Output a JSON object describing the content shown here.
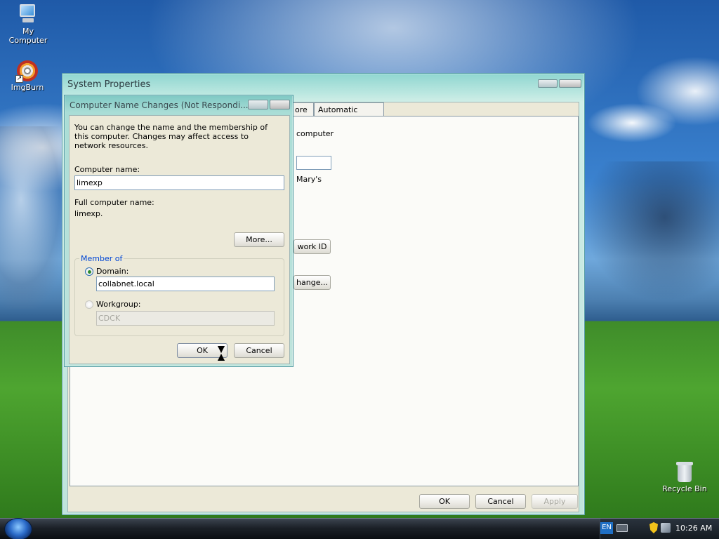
{
  "desktop": {
    "icons": [
      {
        "label": "My Computer"
      },
      {
        "label": "ImgBurn"
      },
      {
        "label": "Recycle Bin"
      }
    ]
  },
  "system_properties": {
    "title": "System Properties",
    "tabs": [
      {
        "label": "ore"
      },
      {
        "label": "Automatic Updates"
      }
    ],
    "panel_fragments": {
      "computer_text": "computer",
      "marys_text": "Mary's"
    },
    "network_id_button": "work ID",
    "change_button": "hange...",
    "ok_button": "OK",
    "cancel_button": "Cancel",
    "apply_button": "Apply"
  },
  "dialog": {
    "title": "Computer Name Changes (Not Respondi...",
    "description": "You can change the name and the membership of this computer. Changes may affect access to network resources.",
    "computer_name_label": "Computer name:",
    "computer_name_value": "limexp",
    "full_name_label": "Full computer name:",
    "full_name_value": "limexp.",
    "more_button": "More...",
    "member_of_label": "Member of",
    "domain_label": "Domain:",
    "domain_value": "collabnet.local",
    "domain_selected": true,
    "workgroup_label": "Workgroup:",
    "workgroup_value": "CDCK",
    "ok_button": "OK",
    "cancel_button": "Cancel"
  },
  "taskbar": {
    "language": "EN",
    "clock": "10:26 AM"
  },
  "colors": {
    "title_glass": "#a9ddd6",
    "dialog_face": "#ece9d8",
    "group_legend": "#0046d5",
    "taskbar": "#1c2128"
  }
}
